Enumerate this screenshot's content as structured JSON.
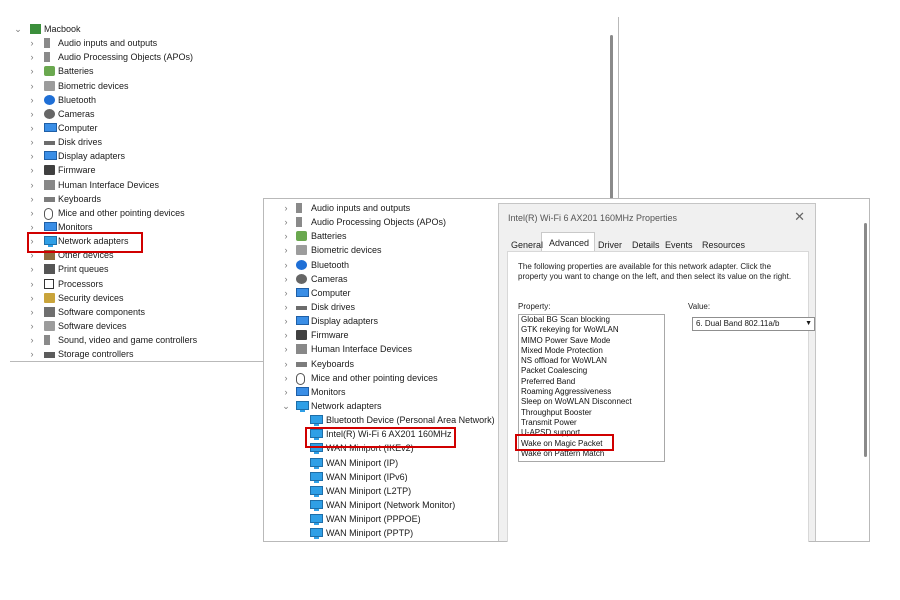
{
  "back_tree": {
    "root": "Macbook",
    "items": [
      "Audio inputs and outputs",
      "Audio Processing Objects (APOs)",
      "Batteries",
      "Biometric devices",
      "Bluetooth",
      "Cameras",
      "Computer",
      "Disk drives",
      "Display adapters",
      "Firmware",
      "Human Interface Devices",
      "Keyboards",
      "Mice and other pointing devices",
      "Monitors",
      "Network adapters",
      "Other devices",
      "Print queues",
      "Processors",
      "Security devices",
      "Software components",
      "Software devices",
      "Sound, video and game controllers",
      "Storage controllers"
    ],
    "icons": [
      "audio-icon",
      "audio-icon",
      "battery-icon",
      "biometric-icon",
      "bluetooth-icon",
      "camera-icon",
      "computer-icon",
      "disk-icon",
      "display-icon",
      "firmware-icon",
      "hid-icon",
      "keyboard-icon",
      "mouse-icon",
      "monitor-icon",
      "network-icon",
      "other-icon",
      "printer-icon",
      "processor-icon",
      "security-icon",
      "software-component-icon",
      "software-device-icon",
      "sound-icon",
      "storage-icon"
    ]
  },
  "front_tree": {
    "items": [
      "Audio inputs and outputs",
      "Audio Processing Objects (APOs)",
      "Batteries",
      "Biometric devices",
      "Bluetooth",
      "Cameras",
      "Computer",
      "Disk drives",
      "Display adapters",
      "Firmware",
      "Human Interface Devices",
      "Keyboards",
      "Mice and other pointing devices",
      "Monitors",
      "Network adapters"
    ],
    "network_children": [
      "Bluetooth Device (Personal Area Network)",
      "Intel(R) Wi-Fi 6 AX201 160MHz",
      "WAN Miniport (IKEv2)",
      "WAN Miniport (IP)",
      "WAN Miniport (IPv6)",
      "WAN Miniport (L2TP)",
      "WAN Miniport (Network Monitor)",
      "WAN Miniport (PPPOE)",
      "WAN Miniport (PPTP)"
    ]
  },
  "dialog": {
    "title": "Intel(R) Wi-Fi 6 AX201 160MHz Properties",
    "close": "✕",
    "tabs": [
      "General",
      "Advanced",
      "Driver",
      "Details",
      "Events",
      "Resources"
    ],
    "active_tab": "Advanced",
    "description": "The following properties are available for this network adapter. Click the property you want to change on the left, and then select its value on the right.",
    "property_label": "Property:",
    "value_label": "Value:",
    "properties": [
      "Global BG Scan blocking",
      "GTK rekeying for WoWLAN",
      "MIMO Power Save Mode",
      "Mixed Mode Protection",
      "NS offload for WoWLAN",
      "Packet Coalescing",
      "Preferred Band",
      "Roaming Aggressiveness",
      "Sleep on WoWLAN Disconnect",
      "Throughput Booster",
      "Transmit Power",
      "U-APSD support",
      "Wake on Magic Packet",
      "Wake on Pattern Match"
    ],
    "selected_property": "Wake on Magic Packet",
    "value": "6. Dual Band 802.11a/b",
    "arrow": "▼"
  },
  "glyphs": {
    "chevron_right": "›",
    "chevron_down": "⌄"
  },
  "colors": {
    "highlight": "#d00000",
    "accent": "#2f9fe6"
  }
}
